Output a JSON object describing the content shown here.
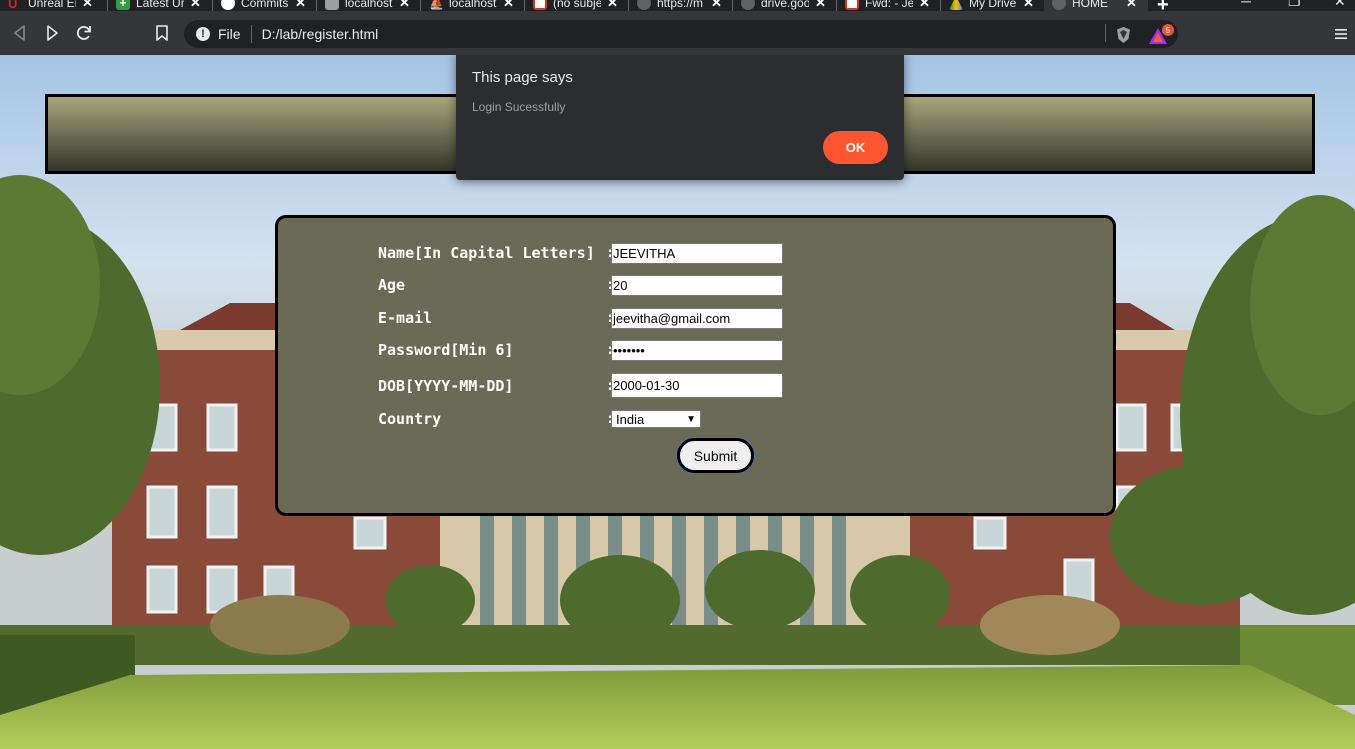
{
  "tabs": [
    {
      "title": "Unreal Er",
      "icon": "unreal-icon",
      "color": "#c62828"
    },
    {
      "title": "Latest Ur",
      "icon": "plus-square-icon",
      "color": "#2e9e3e"
    },
    {
      "title": "Commits",
      "icon": "github-icon",
      "color": "#ffffff"
    },
    {
      "title": "localhost",
      "icon": "phpmyadmin-icon",
      "color": "#9e9e9e"
    },
    {
      "title": "localhost",
      "icon": "sailboat-icon",
      "color": "#9e9e9e"
    },
    {
      "title": "(no subje",
      "icon": "gmail-icon",
      "color": "#d93025"
    },
    {
      "title": "https://m",
      "icon": "globe-icon",
      "color": "#9aa0a6"
    },
    {
      "title": "drive.goo",
      "icon": "globe-icon",
      "color": "#9aa0a6"
    },
    {
      "title": "Fwd: - Je",
      "icon": "gmail-icon",
      "color": "#d93025"
    },
    {
      "title": "My Drive",
      "icon": "google-drive-icon",
      "color": "#1e8e3e"
    },
    {
      "title": "HOME",
      "icon": "globe-icon",
      "color": "#9aa0a6",
      "active": true
    }
  ],
  "address_bar": {
    "scheme_label": "File",
    "url": "D:/lab/register.html"
  },
  "extensions": {
    "rewards_badge": "5"
  },
  "dialog": {
    "title": "This page says",
    "message": "Login Sucessfully",
    "ok_label": "OK"
  },
  "form": {
    "fields": [
      {
        "label": "Name[In Capital Letters]",
        "value": "JEEVITHA"
      },
      {
        "label": "Age",
        "value": "20"
      },
      {
        "label": "E-mail",
        "value": "jeevitha@gmail.com"
      },
      {
        "label": "Password[Min 6]",
        "value": "•••••••"
      },
      {
        "label": "DOB[YYYY-MM-DD]",
        "value": "2000-01-30"
      },
      {
        "label": "Country",
        "value": "India"
      }
    ],
    "separator": ":",
    "submit_label": "Submit"
  },
  "colors": {
    "panel": "#6b6a56",
    "accent_ok": "#ff5530",
    "chrome_dark": "#202124",
    "chrome_toolbar": "#35363a"
  }
}
